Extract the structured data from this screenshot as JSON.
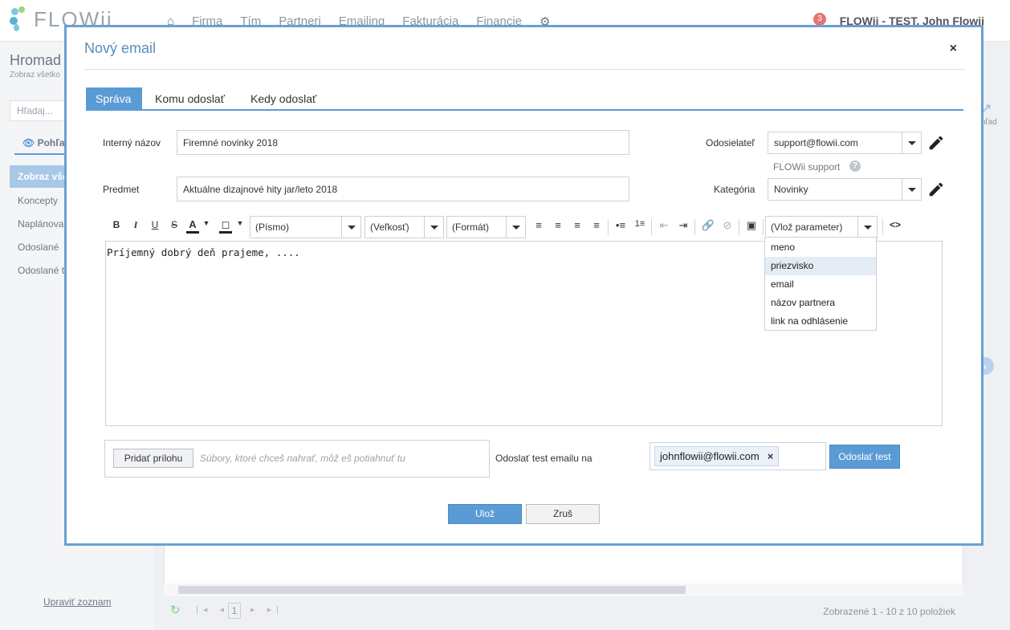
{
  "app": {
    "logo_text": "FLOWii",
    "nav": [
      "Firma",
      "Tím",
      "Partneri",
      "Emailing",
      "Fakturácia",
      "Financie"
    ],
    "notification_count": "3",
    "user": "FLOWii - TEST, John Flowii"
  },
  "left_panel": {
    "title": "Hromad",
    "subtitle": "Zobraz všetko",
    "search_placeholder": "Hľadaj...",
    "view_label": "Pohľa",
    "items": [
      "Zobraz vše",
      "Koncepty",
      "Naplánova",
      "Odoslané",
      "Odoslané t"
    ],
    "edit_list": "Upraviť zoznam"
  },
  "background": {
    "page_number": "1",
    "status": "Zobrazené 1 - 10 z 10 položiek",
    "right_label": "hľad"
  },
  "modal": {
    "title": "Nový email",
    "close_label": "×",
    "tabs": [
      "Správa",
      "Komu odoslať",
      "Kedy odoslať"
    ],
    "internal_name_label": "Interný názov",
    "internal_name_value": "Firemné novinky 2018",
    "subject_label": "Predmet",
    "subject_value": "Aktuálne dizajnové hity jar/leto 2018",
    "sender_label": "Odosielateľ",
    "sender_value": "support@flowii.com",
    "sender_name": "FLOWii support",
    "category_label": "Kategória",
    "category_value": "Novinky",
    "editor": {
      "font_select": "(Písmo)",
      "size_select": "(Veľkosť)",
      "format_select": "(Formát)",
      "param_select": "(Vlož parameter)",
      "content": "Príjemný dobrý deň prajeme, ....",
      "param_options": [
        "meno",
        "priezvisko",
        "email",
        "názov partnera",
        "link na odhlásenie"
      ],
      "highlighted_option": "priezvisko"
    },
    "attach_button": "Pridať prílohu",
    "attach_hint": "Súbory, ktoré chceš nahrať, môž eš potiahnuť tu",
    "test_label": "Odoslať test emailu na",
    "test_email": "johnflowii@flowii.com",
    "test_button": "Odoslať test",
    "save_button": "Ulož",
    "cancel_button": "Zruš"
  },
  "colors": {
    "accent": "#5b9bd5",
    "modal_border": "#6aa0d2",
    "highlight": "#e4ecf5"
  }
}
